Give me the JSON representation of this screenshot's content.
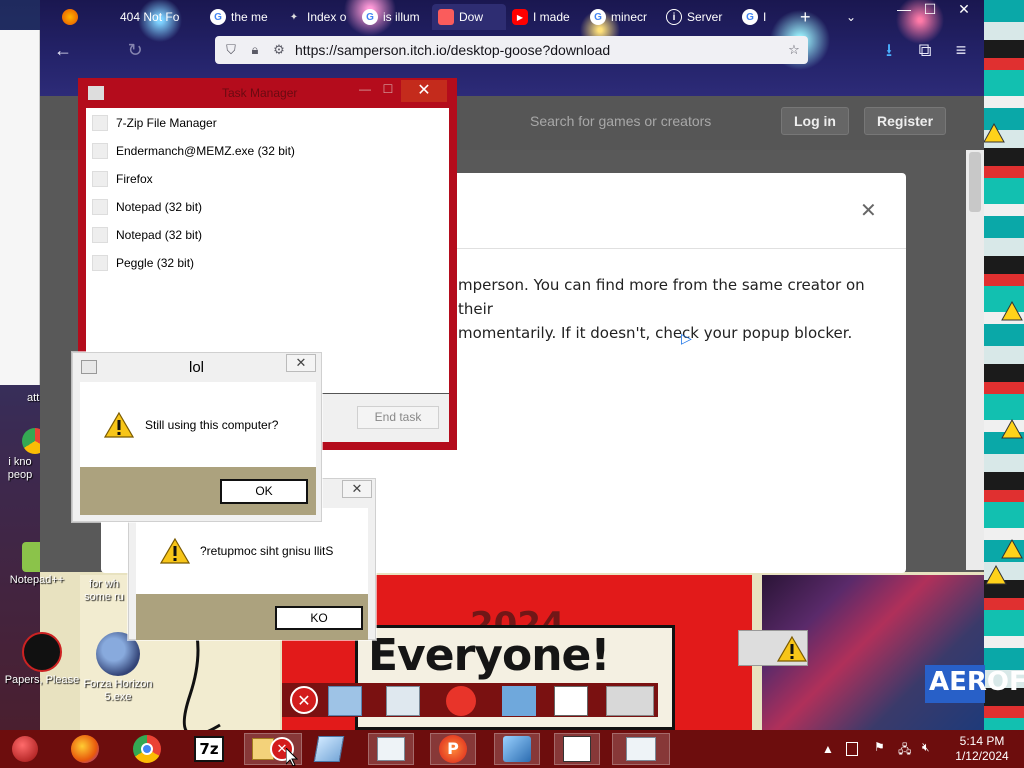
{
  "browser": {
    "tabs": [
      {
        "label": "404 Not Fo",
        "icon": "firefox-icon"
      },
      {
        "label": "the me",
        "icon": "google-icon"
      },
      {
        "label": "Index o",
        "icon": "puzzle-icon"
      },
      {
        "label": "is illum",
        "icon": "google-icon"
      },
      {
        "label": "Dow",
        "icon": "itch-icon"
      },
      {
        "label": "I made",
        "icon": "youtube-icon"
      },
      {
        "label": "minecr",
        "icon": "google-icon"
      },
      {
        "label": "Server",
        "icon": "info-icon"
      },
      {
        "label": "I",
        "icon": "google-icon"
      }
    ],
    "url": "https://samperson.itch.io/desktop-goose?download",
    "new_tab": "+",
    "tab_overflow": "⌄"
  },
  "itch": {
    "search_placeholder": "Search for games or creators",
    "login": "Log in",
    "register": "Register",
    "modal_line1": "mperson. You can find more from the same creator on their",
    "modal_line2": "momentarily. If it doesn't, check your popup blocker.",
    "close": "✕"
  },
  "task_manager": {
    "processes": [
      "7-Zip File Manager",
      "Endermanch@MEMZ.exe (32 bit)",
      "Firefox",
      "Notepad (32 bit)",
      "Notepad (32 bit)",
      "Peggle (32 bit)"
    ],
    "end_task": "End task"
  },
  "dialog1": {
    "title": "lol",
    "message": "Still using this computer?",
    "ok": "OK"
  },
  "dialog2": {
    "message": "?retupmoc siht gnisu llitS",
    "ok": "KO"
  },
  "desktop": {
    "icons": [
      {
        "label": "Notepad++"
      },
      {
        "label": "for wh some ru"
      },
      {
        "label": "Papers, Please"
      },
      {
        "label": "Forza Horizon 5.exe"
      },
      {
        "label": "i kno peop"
      },
      {
        "label": "attr"
      }
    ],
    "banner_text": "Everyone!",
    "city_sign": "AEROF"
  },
  "taskbar": {
    "time": "5:14 PM",
    "date": "1/12/2024"
  },
  "colors": {
    "taskbar": "#6d0d0d",
    "task_manager_frame": "#b40c1c",
    "dialog_footer": "#aca27e",
    "error_red": "#d31c1c"
  }
}
